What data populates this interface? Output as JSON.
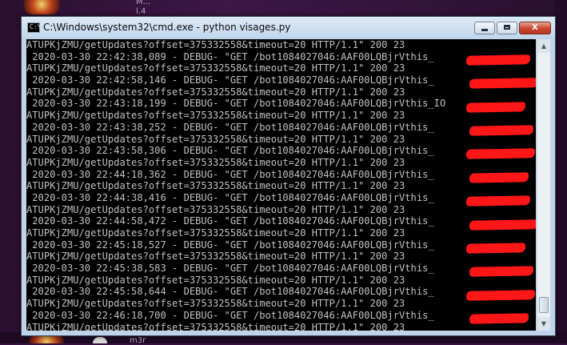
{
  "desktop": {
    "top_label": "M...",
    "top_label2": "l.4",
    "bottom_label": "m3r"
  },
  "window": {
    "title": "C:\\Windows\\system32\\cmd.exe - python  visages.py",
    "icon_glyph": "C:\\",
    "buttons": {
      "minimize": "–",
      "maximize": "□",
      "close": "X"
    }
  },
  "console": {
    "lines": [
      "ATUPKjZMU/getUpdates?offset=375332558&timeout=20 HTTP/1.1\" 200 23",
      " 2020-03-30 22:42:38,089 - DEBUG- \"GET /bot1084027046:AAF00LQBjrVthis_",
      "ATUPKjZMU/getUpdates?offset=375332558&timeout=20 HTTP/1.1\" 200 23",
      " 2020-03-30 22:42:58,146 - DEBUG- \"GET /bot1084027046:AAF00LQBjrVthis_",
      "ATUPKjZMU/getUpdates?offset=375332558&timeout=20 HTTP/1.1\" 200 23",
      " 2020-03-30 22:43:18,199 - DEBUG- \"GET /bot1084027046:AAF00LQBjrVthis_IO",
      "ATUPKjZMU/getUpdates?offset=375332558&timeout=20 HTTP/1.1\" 200 23",
      " 2020-03-30 22:43:38,252 - DEBUG- \"GET /bot1084027046:AAF00LQBjrVthis_",
      "ATUPKjZMU/getUpdates?offset=375332558&timeout=20 HTTP/1.1\" 200 23",
      " 2020-03-30 22:43:58,306 - DEBUG- \"GET /bot1084027046:AAF00LQBjrVthis_",
      "ATUPKjZMU/getUpdates?offset=375332558&timeout=20 HTTP/1.1\" 200 23",
      " 2020-03-30 22:44:18,362 - DEBUG- \"GET /bot1084027046:AAF00LQBjrVthis_",
      "ATUPKjZMU/getUpdates?offset=375332558&timeout=20 HTTP/1.1\" 200 23",
      " 2020-03-30 22:44:38,416 - DEBUG- \"GET /bot1084027046:AAF00LQBjrVthis_",
      "ATUPKjZMU/getUpdates?offset=375332558&timeout=20 HTTP/1.1\" 200 23",
      " 2020-03-30 22:44:58,472 - DEBUG- \"GET /bot1084027046:AAF00LQBjrVthis_",
      "ATUPKjZMU/getUpdates?offset=375332558&timeout=20 HTTP/1.1\" 200 23",
      " 2020-03-30 22:45:18,527 - DEBUG- \"GET /bot1084027046:AAF00LQBjrVthis_",
      "ATUPKjZMU/getUpdates?offset=375332558&timeout=20 HTTP/1.1\" 200 23",
      " 2020-03-30 22:45:38,583 - DEBUG- \"GET /bot1084027046:AAF00LQBjrVthis_",
      "ATUPKjZMU/getUpdates?offset=375332558&timeout=20 HTTP/1.1\" 200 23",
      " 2020-03-30 22:45:58,644 - DEBUG- \"GET /bot1084027046:AAF00LQBjrVthis_",
      "ATUPKjZMU/getUpdates?offset=375332558&timeout=20 HTTP/1.1\" 200 23",
      " 2020-03-30 22:46:18,700 - DEBUG- \"GET /bot1084027046:AAF00LQBjrVthis_",
      "ATUPKjZMU/getUpdates?offset=375332558&timeout=20 HTTP/1.1\" 200 23"
    ],
    "redaction_color": "#ff1616",
    "text_color": "#c0c0c0",
    "background": "#000000"
  },
  "scrollbar": {
    "up_glyph": "▲",
    "down_glyph": "▼"
  }
}
